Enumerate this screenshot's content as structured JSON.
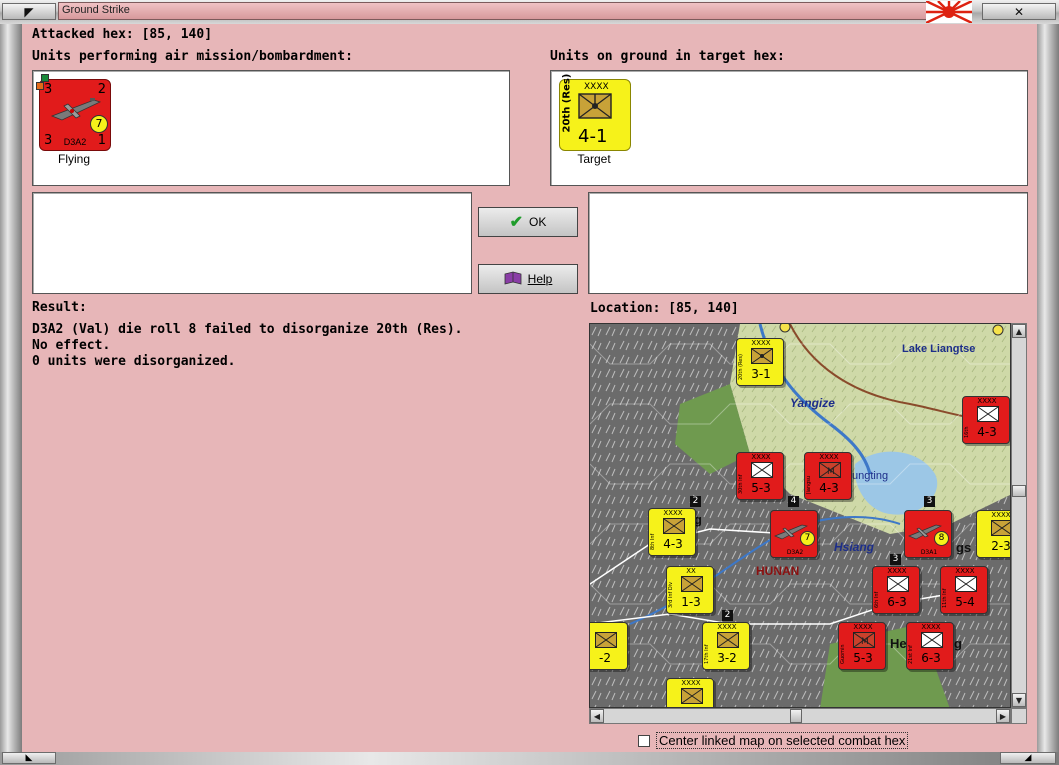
{
  "window": {
    "title": "Ground Strike"
  },
  "attacked_hex": {
    "label": "Attacked hex:",
    "value": "[85, 140]"
  },
  "air_units": {
    "label": "Units performing air mission/bombardment:",
    "units": [
      {
        "type_code": "D3A2",
        "attack": "3",
        "range": "2",
        "defense": "3",
        "moves": "1",
        "strength": "7",
        "status": "Flying",
        "color": "#e11b1b"
      }
    ]
  },
  "ground_units": {
    "label": "Units on ground in target hex:",
    "units": [
      {
        "name": "20th (Res)",
        "size": "XXXX",
        "combat": "4-1",
        "status": "Target",
        "color": "#f6f21a"
      }
    ]
  },
  "buttons": {
    "ok_label": "OK",
    "help_label": "Help"
  },
  "result": {
    "label": "Result:",
    "lines": [
      "D3A2 (Val) die roll 8 failed to disorganize 20th (Res).",
      "No effect.",
      "0 units were disorganized."
    ]
  },
  "location": {
    "label": "Location:",
    "value": "[85, 140]"
  },
  "map": {
    "labels": {
      "lake": "Lake Liangtse",
      "river": "Yangize",
      "town1": "ungting",
      "town2": "Hsiang",
      "province": "HUNAN",
      "city_a": "ng",
      "city_b": "gs",
      "city_c": "He",
      "city_d": "g"
    },
    "counters": [
      {
        "id": "c1",
        "top": "XXXX",
        "mid": "3-1",
        "side": "20th (Res)",
        "color": "#f6f21a",
        "kind": "hq"
      },
      {
        "id": "c2",
        "top": "XXXX",
        "mid": "5-3",
        "side": "30th Inf",
        "color": "#e11b1b",
        "kind": "inf"
      },
      {
        "id": "c3",
        "top": "XXXX",
        "mid": "4-3",
        "side": "Jiangsu",
        "color": "#e11b1b",
        "kind": "mech"
      },
      {
        "id": "c4",
        "top": "XXXX",
        "mid": "4-3",
        "side": "16th",
        "color": "#e11b1b",
        "kind": "inf"
      },
      {
        "id": "c5",
        "top": "XXXX",
        "mid": "4-3",
        "side": "8th Inf",
        "color": "#f6f21a",
        "kind": "mixed"
      },
      {
        "id": "c6",
        "top": "",
        "mid": "7",
        "side": "D3A2",
        "color": "#e11b1b",
        "kind": "air"
      },
      {
        "id": "c7",
        "top": "",
        "mid": "8",
        "side": "D3A1",
        "color": "#e11b1b",
        "kind": "air"
      },
      {
        "id": "c8",
        "top": "XXXX",
        "mid": "2-3",
        "side": "",
        "color": "#f6f21a",
        "kind": "inf"
      },
      {
        "id": "c9",
        "top": "XX",
        "mid": "1-3",
        "side": "3rd Inf Div",
        "color": "#f6f21a",
        "kind": "inf"
      },
      {
        "id": "c10",
        "top": "XXXX",
        "mid": "6-3",
        "side": "6th Inf",
        "color": "#e11b1b",
        "kind": "inf"
      },
      {
        "id": "c11",
        "top": "XXXX",
        "mid": "5-4",
        "side": "11th Inf",
        "color": "#e11b1b",
        "kind": "mixed"
      },
      {
        "id": "c12",
        "top": "XXXX",
        "mid": "3-2",
        "side": "17th Inf",
        "color": "#f6f21a",
        "kind": "mixed"
      },
      {
        "id": "c13",
        "top": "",
        "mid": "-2",
        "side": "",
        "color": "#f6f21a",
        "kind": "mixed"
      },
      {
        "id": "c14",
        "top": "XXXX",
        "mid": "5-3",
        "side": "Guomin",
        "color": "#e11b1b",
        "kind": "mech"
      },
      {
        "id": "c15",
        "top": "XXXX",
        "mid": "6-3",
        "side": "21st Inf",
        "color": "#e11b1b",
        "kind": "mixed"
      },
      {
        "id": "c16",
        "top": "XXXX",
        "mid": "",
        "side": "",
        "color": "#f6f21a",
        "kind": "mixed"
      }
    ],
    "stack_badges": [
      "2",
      "4",
      "3",
      "3",
      "2"
    ]
  },
  "center_checkbox": {
    "label": "Center linked map on selected combat hex",
    "checked": false
  }
}
